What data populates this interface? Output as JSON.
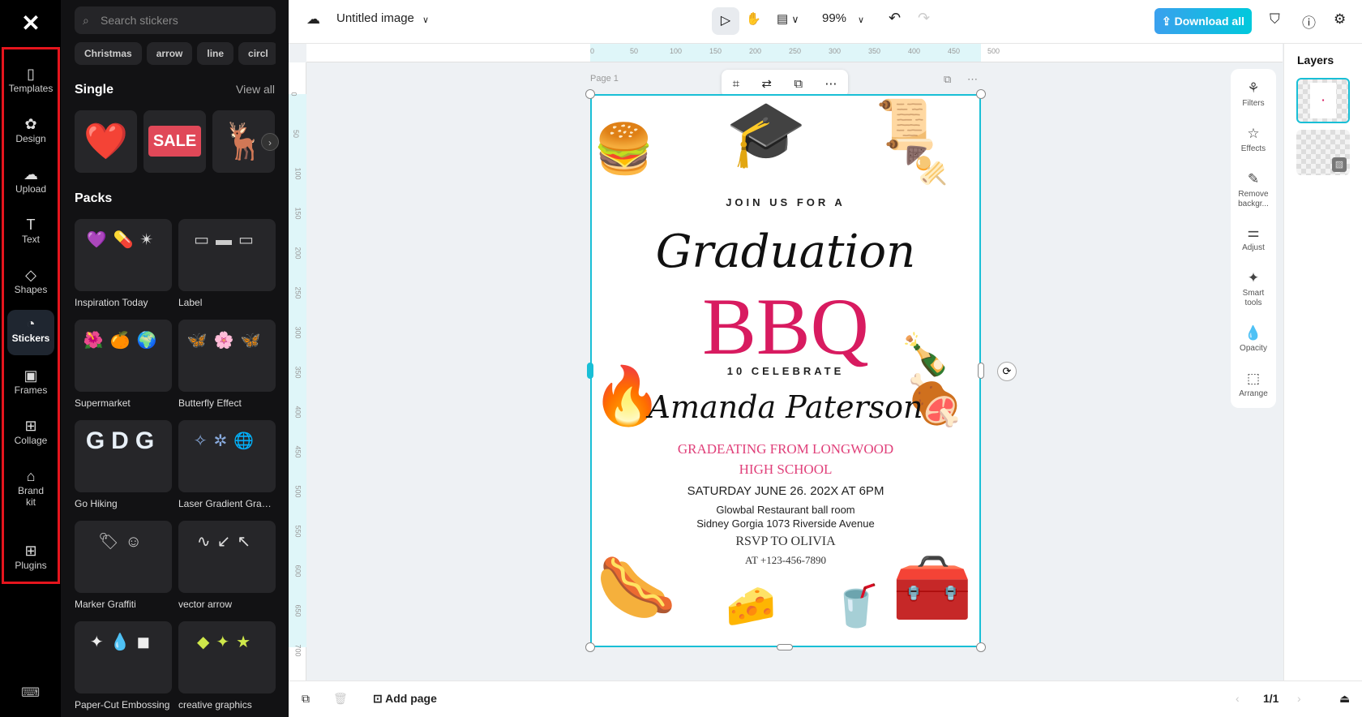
{
  "rail": {
    "items": [
      {
        "label": "Templates",
        "icon": "templates-icon",
        "glyph": "▯"
      },
      {
        "label": "Design",
        "icon": "design-icon",
        "glyph": "✿"
      },
      {
        "label": "Upload",
        "icon": "upload-icon",
        "glyph": "☁"
      },
      {
        "label": "Text",
        "icon": "text-icon",
        "glyph": "T"
      },
      {
        "label": "Shapes",
        "icon": "shapes-icon",
        "glyph": "◇"
      },
      {
        "label": "Stickers",
        "icon": "stickers-icon",
        "glyph": "◔"
      },
      {
        "label": "Frames",
        "icon": "frames-icon",
        "glyph": "▣"
      },
      {
        "label": "Collage",
        "icon": "collage-icon",
        "glyph": "⊞"
      },
      {
        "label": "Brand kit",
        "icon": "brand-kit-icon",
        "glyph": "⌂"
      },
      {
        "label": "Plugins",
        "icon": "plugins-icon",
        "glyph": "⊞"
      }
    ]
  },
  "panel": {
    "search_placeholder": "Search stickers",
    "chips": [
      "Christmas",
      "arrow",
      "line",
      "circl"
    ],
    "single_title": "Single",
    "view_all": "View all",
    "packs_title": "Packs",
    "packs": [
      {
        "label": "Inspiration Today",
        "preview": "💜💊✴"
      },
      {
        "label": "Label",
        "preview": "▭▬▭"
      },
      {
        "label": "Supermarket",
        "preview": "🌺🍊🌍"
      },
      {
        "label": "Butterfly Effect",
        "preview": "🦋🌸🦋"
      },
      {
        "label": "Go Hiking",
        "preview": "GDG"
      },
      {
        "label": "Laser Gradient Graph...",
        "preview": "✧✲🌐"
      },
      {
        "label": "Marker Graffiti",
        "preview": "🏷☺"
      },
      {
        "label": "vector arrow",
        "preview": "∿↙↖"
      },
      {
        "label": "Paper-Cut Embossing",
        "preview": "✦💧◼"
      },
      {
        "label": "creative graphics",
        "preview": "◆✦★"
      }
    ]
  },
  "topbar": {
    "title": "Untitled image",
    "zoom": "99%",
    "download": "Download all"
  },
  "ruler": {
    "h": [
      "0",
      "50",
      "100",
      "150",
      "200",
      "250",
      "300",
      "350",
      "400",
      "450",
      "500"
    ],
    "v": [
      "0",
      "50",
      "100",
      "150",
      "200",
      "250",
      "300",
      "350",
      "400",
      "450",
      "500",
      "550",
      "600",
      "650",
      "700"
    ]
  },
  "canvas": {
    "page_label": "Page 1"
  },
  "poster": {
    "join": "JOIN US FOR A",
    "graduation": "Graduation",
    "bbq": "BBQ",
    "celebrate": "10 CELEBRATE",
    "name": "Amanda Paterson",
    "school1": "GRADEATING FROM LONGWOOD",
    "school2": "HIGH SCHOOL",
    "date": "SATURDAY JUNE 26. 202X AT 6PM",
    "venue1": "Glowbal Restaurant ball room",
    "venue2": "Sidney Gorgia 1073 Riverside Avenue",
    "rsvp": "RSVP TO OLIVIA",
    "phone": "AT +123-456-7890"
  },
  "tools": [
    "Filters",
    "Effects",
    "Remove backgr...",
    "Adjust",
    "Smart tools",
    "Opacity",
    "Arrange"
  ],
  "layers": {
    "title": "Layers"
  },
  "bottom": {
    "add_page": "Add page",
    "pages": "1/1"
  },
  "colors": {
    "accent": "#19bfd6",
    "bbq": "#d81b60",
    "highlight": "#e5151d"
  }
}
